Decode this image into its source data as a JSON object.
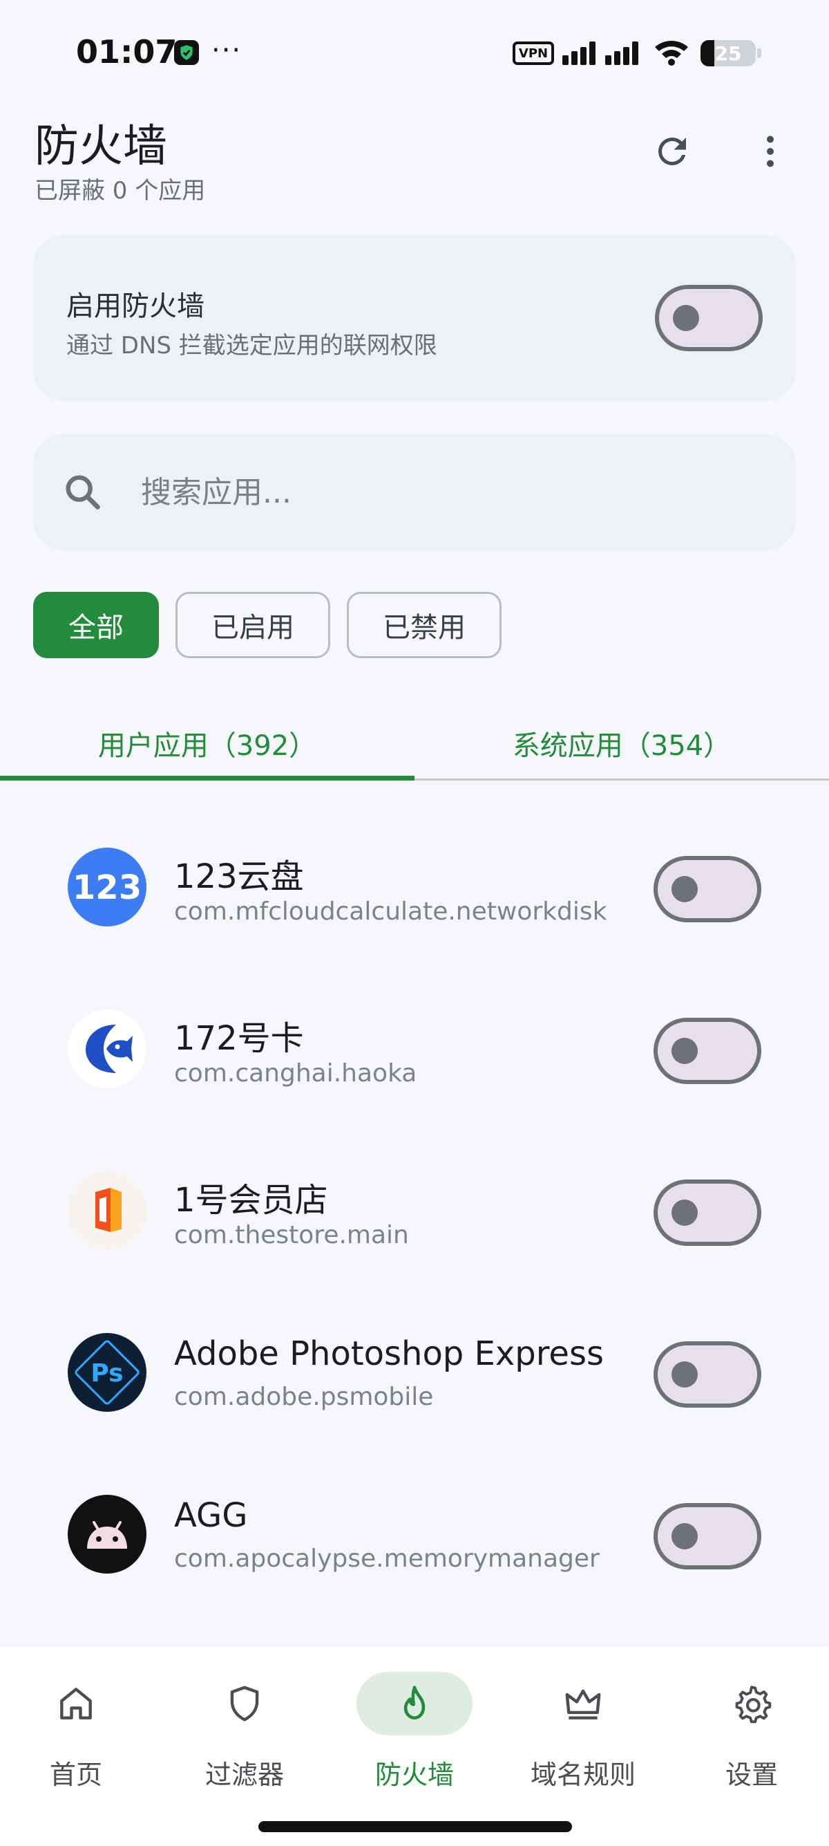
{
  "status_bar": {
    "time": "01:07",
    "notification_dots": "···",
    "vpn_label": "VPN",
    "battery_percent": "25",
    "battery_level": 0.25,
    "icons": [
      "shield-check-icon",
      "signal-icon",
      "wifi-icon",
      "battery-icon"
    ]
  },
  "header": {
    "title": "防火墙",
    "subtitle": "已屏蔽 0 个应用",
    "icons": [
      "refresh-icon",
      "more-vert-icon"
    ]
  },
  "firewall_card": {
    "title": "启用防火墙",
    "description": "通过 DNS 拦截选定应用的联网权限",
    "enabled": false
  },
  "search": {
    "placeholder": "搜索应用...",
    "value": ""
  },
  "filters": {
    "all": "全部",
    "enabled": "已启用",
    "disabled": "已禁用",
    "selected": "all"
  },
  "tabs": {
    "user_apps": "用户应用（392）",
    "system_apps": "系统应用（354）",
    "selected": "user_apps"
  },
  "apps": [
    {
      "name": "123云盘",
      "package": "com.mfcloudcalculate.networkdisk",
      "blocked": false,
      "icon": "cloud-123-icon"
    },
    {
      "name": "172号卡",
      "package": "com.canghai.haoka",
      "blocked": false,
      "icon": "haoka-fish-icon"
    },
    {
      "name": "1号会员店",
      "package": "com.thestore.main",
      "blocked": false,
      "icon": "thestore-icon"
    },
    {
      "name": "Adobe Photoshop Express",
      "package": "com.adobe.psmobile",
      "blocked": false,
      "icon": "photoshop-icon"
    },
    {
      "name": "AGG",
      "package": "com.apocalypse.memorymanager",
      "blocked": false,
      "icon": "android-icon"
    }
  ],
  "bottom_nav": {
    "home": "首页",
    "filters": "过滤器",
    "firewall": "防火墙",
    "domain_rules": "域名规则",
    "settings": "设置",
    "selected": "firewall"
  },
  "colors": {
    "accent": "#238b3b",
    "background": "#f5f7fa",
    "card": "#edf0f4",
    "switch_track": "#e6e0ea",
    "switch_outline": "#6e7177",
    "ps_blue": "#31a8ff",
    "ps_dark": "#001e36"
  }
}
